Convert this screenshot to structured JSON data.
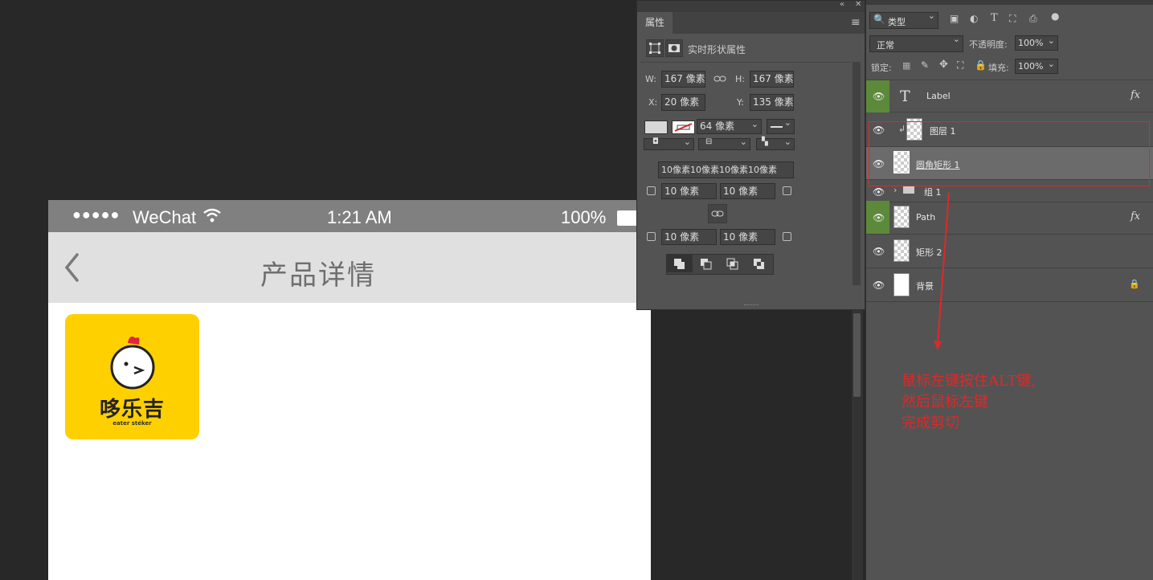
{
  "phone": {
    "status": {
      "signal": "●●●●●",
      "carrier": "WeChat",
      "time": "1:21 AM",
      "battery": "100%"
    },
    "nav": {
      "title": "产品详情",
      "back_icon": "chevron-left-icon"
    },
    "logo": {
      "brand": "哆乐吉",
      "tagline": "eater stéker",
      "background": "#ffd000"
    }
  },
  "properties": {
    "tab": "属性",
    "shape_title": "实时形状属性",
    "w_label": "W:",
    "w": "167 像素",
    "h_label": "H:",
    "h": "167 像素",
    "x_label": "X:",
    "x": "20 像素",
    "y_label": "Y:",
    "y": "135 像素",
    "stroke_width": "64 像素",
    "corners_all": "10像素10像素10像素10像素",
    "corner_tl": "10 像素",
    "corner_tr": "10 像素",
    "corner_bl": "10 像素",
    "corner_br": "10 像素"
  },
  "layers": {
    "search_kind": "类型",
    "blend_mode": "正常",
    "opacity_label": "不透明度:",
    "opacity": "100%",
    "lock_label": "锁定:",
    "fill_label": "填充:",
    "fill": "100%",
    "accent_green": "#5c8a3a",
    "items": [
      {
        "name": "Label",
        "type": "text",
        "fx": "fx"
      },
      {
        "name": "图层 1",
        "type": "pixel"
      },
      {
        "name": "圆角矩形 1",
        "type": "shape"
      },
      {
        "name": "组 1",
        "type": "group"
      },
      {
        "name": "Path",
        "type": "shape",
        "fx": "fx"
      },
      {
        "name": "矩形 2",
        "type": "shape"
      },
      {
        "name": "背景",
        "type": "background"
      }
    ]
  },
  "annotation": {
    "line1": "鼠标左键按住ALT键,",
    "line2": "然后鼠标左键",
    "line3": "完成剪切",
    "color": "#e02828"
  }
}
